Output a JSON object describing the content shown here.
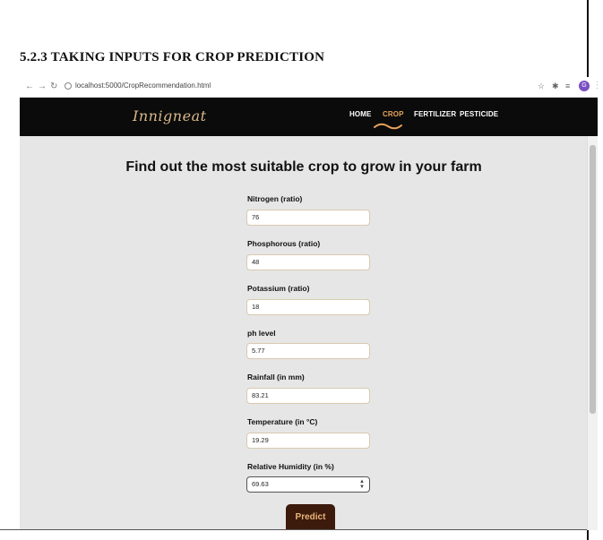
{
  "document": {
    "heading": "5.2.3 TAKING INPUTS FOR CROP PREDICTION"
  },
  "browser": {
    "url": "localhost:5000/CropRecommendation.html",
    "profile_initial": "G"
  },
  "navbar": {
    "brand": "Innigneat",
    "items": [
      "HOME",
      "CROP",
      "FERTILIZER",
      "PESTICIDE"
    ],
    "active": "CROP",
    "colors": {
      "background": "#0b0b0b",
      "brand": "#d8b78a",
      "active": "#e8a25c"
    }
  },
  "form": {
    "title": "Find out the most suitable crop to grow in your farm",
    "fields": [
      {
        "label": "Nitrogen (ratio)",
        "value": "76"
      },
      {
        "label": "Phosphorous (ratio)",
        "value": "48"
      },
      {
        "label": "Potassium (ratio)",
        "value": "18"
      },
      {
        "label": "ph level",
        "value": "5.77"
      },
      {
        "label": "Rainfall (in mm)",
        "value": "83.21"
      },
      {
        "label": "Temperature (in °C)",
        "value": "19.29"
      },
      {
        "label": "Relative Humidity (in %)",
        "value": "69.63"
      }
    ],
    "submit_label": "Predict",
    "colors": {
      "page_background": "#e6e6e6",
      "button": "#3c1a0c",
      "button_text": "#e8b57a"
    }
  }
}
